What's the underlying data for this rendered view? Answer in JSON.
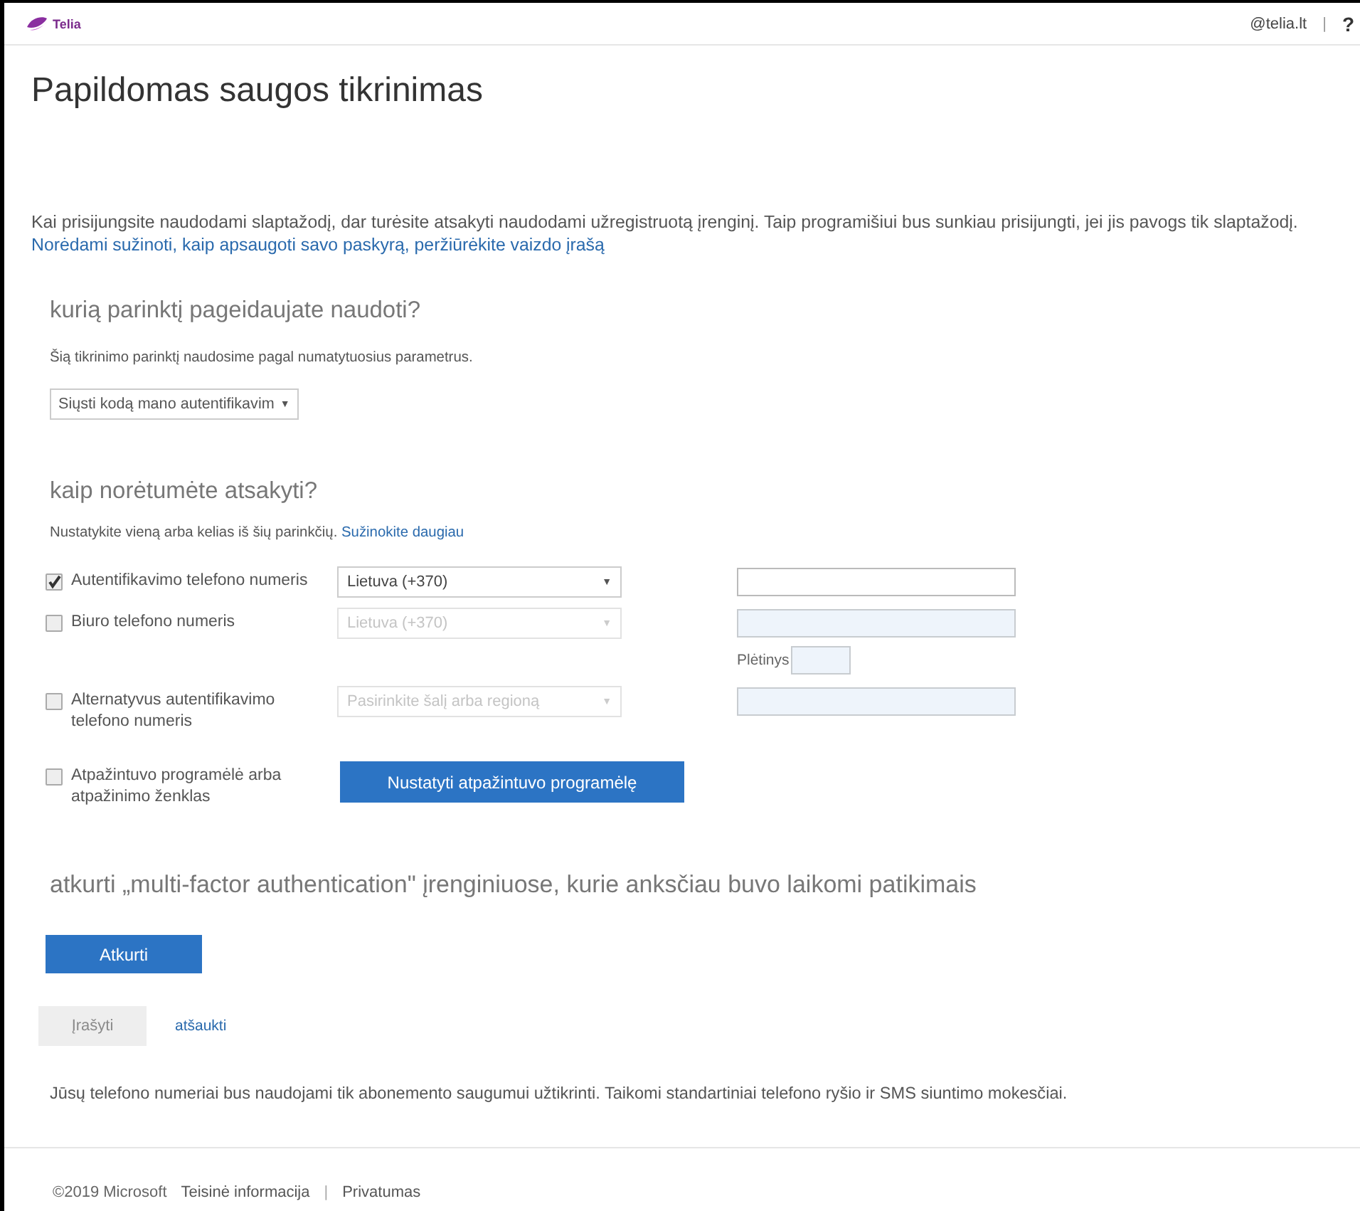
{
  "header": {
    "logo": "Telia",
    "account": "@telia.lt",
    "separator": "|",
    "help": "?"
  },
  "title": "Papildomas saugos tikrinimas",
  "intro": {
    "text": "Kai prisijungsite naudodami slaptažodį, dar turėsite atsakyti naudodami užregistruotą įrenginį. Taip programišiui bus sunkiau prisijungti, jei jis pavogs tik slaptažodį.",
    "link": "Norėdami sužinoti, kaip apsaugoti savo paskyrą, peržiūrėkite vaizdo įrašą"
  },
  "method_section": {
    "heading": "kurią parinktį pageidaujate naudoti?",
    "description": "Šią tikrinimo parinktį naudosime pagal numatytuosius parametrus.",
    "dropdown": {
      "value": "Siųsti kodą mano autentifikavim",
      "caret": "▼"
    }
  },
  "answer_section": {
    "heading": "kaip norėtumėte atsakyti?",
    "description": "Nustatykite vieną arba kelias iš šių parinkčių.",
    "link": "Sužinokite daugiau",
    "options": [
      {
        "kind": "phone",
        "label": "Autentifikavimo telefono numeris",
        "checked": true,
        "disabled": false,
        "country": {
          "value": "Lietuva (+370)",
          "caret": "▼"
        }
      },
      {
        "kind": "phone",
        "label": "Biuro telefono numeris",
        "checked": false,
        "disabled": true,
        "country": {
          "value": "Lietuva (+370)",
          "caret": "▼"
        },
        "extension_label": "Plėtinys"
      },
      {
        "kind": "phone",
        "label": "Alternatyvus autentifikavimo telefono numeris",
        "checked": false,
        "disabled": true,
        "country": {
          "placeholder": "Pasirinkite šalį arba regioną",
          "caret": "▼"
        }
      },
      {
        "kind": "app",
        "label": "Atpažintuvo programėlė arba atpažinimo ženklas",
        "checked": false,
        "button": "Nustatyti atpažintuvo programėlę"
      }
    ]
  },
  "restore_section": {
    "heading": "atkurti „multi-factor authentication\" įrenginiuose, kurie anksčiau buvo laikomi patikimais",
    "button": "Atkurti"
  },
  "actions": {
    "save": {
      "label": "Įrašyti",
      "disabled": true
    },
    "cancel": "atšaukti"
  },
  "note": "Jūsų telefono numeriai bus naudojami tik abonemento saugumui užtikrinti. Taikomi standartiniai telefono ryšio ir SMS siuntimo mokesčiai.",
  "footer": [
    {
      "kind": "text",
      "label": "©2019 Microsoft"
    },
    {
      "kind": "link",
      "label": "Teisinė informacija"
    },
    {
      "kind": "separator",
      "label": "|"
    },
    {
      "kind": "link",
      "label": "Privatumas"
    }
  ]
}
